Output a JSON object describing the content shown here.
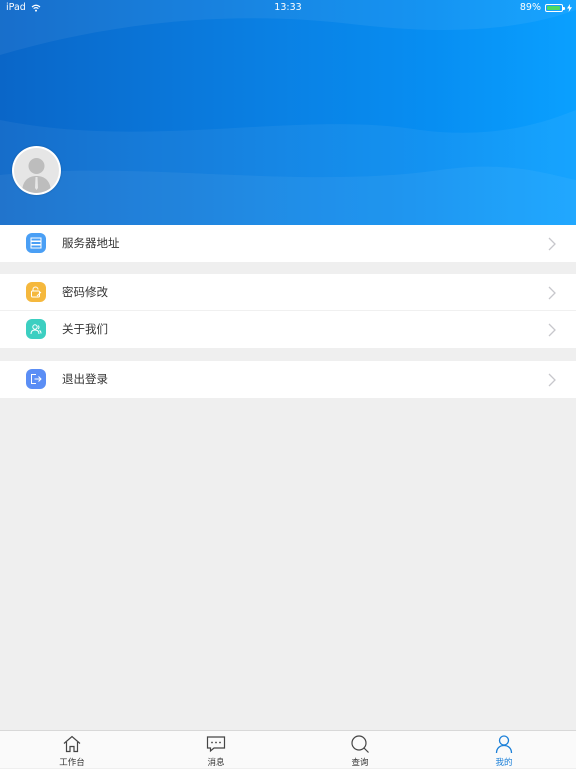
{
  "status_bar": {
    "device": "iPad",
    "time": "13:33",
    "battery": "89%"
  },
  "menu": {
    "group1": [
      {
        "label": "服务器地址",
        "icon": "server-icon",
        "color": "#4a9ff5"
      }
    ],
    "group2": [
      {
        "label": "密码修改",
        "icon": "password-edit-icon",
        "color": "#f5b83d"
      },
      {
        "label": "关于我们",
        "icon": "about-us-icon",
        "color": "#3ccfc1"
      }
    ],
    "group3": [
      {
        "label": "退出登录",
        "icon": "logout-icon",
        "color": "#5b8ef5"
      }
    ]
  },
  "tabbar": {
    "items": [
      {
        "label": "工作台",
        "icon": "home-icon"
      },
      {
        "label": "消息",
        "icon": "message-icon"
      },
      {
        "label": "查询",
        "icon": "search-icon"
      },
      {
        "label": "我的",
        "icon": "user-icon"
      }
    ],
    "active": "我的",
    "active_color": "#1a7fd8"
  },
  "colors": {
    "header_gradient_start": "#0a66c8",
    "header_gradient_end": "#0aa0ff",
    "background": "#efefef"
  }
}
